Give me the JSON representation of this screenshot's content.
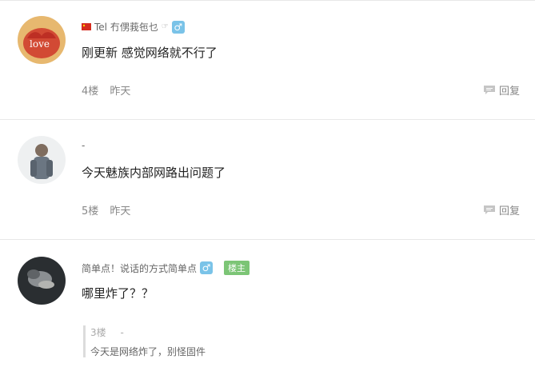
{
  "comments": [
    {
      "username": "Tel 冇侽莪㐌乜",
      "content": "刚更新 感觉网络就不行了",
      "floor": "4楼",
      "time": "昨天",
      "reply_label": "回复"
    },
    {
      "username": "-",
      "content": "今天魅族内部网路出问题了",
      "floor": "5楼",
      "time": "昨天",
      "reply_label": "回复"
    },
    {
      "username": "简单点！说话的方式简单点",
      "badge": "楼主",
      "content": "哪里炸了？？",
      "sub_reply": {
        "floor": "3楼",
        "sep": "-",
        "text": "今天是网络炸了，别怪固件"
      }
    }
  ],
  "icons": {
    "gender": "male-icon",
    "reply": "comment-bubble-icon",
    "flag": "china-flag-icon"
  },
  "colors": {
    "gender_bg": "#7ac3e8",
    "owner_badge": "#7cc576"
  }
}
